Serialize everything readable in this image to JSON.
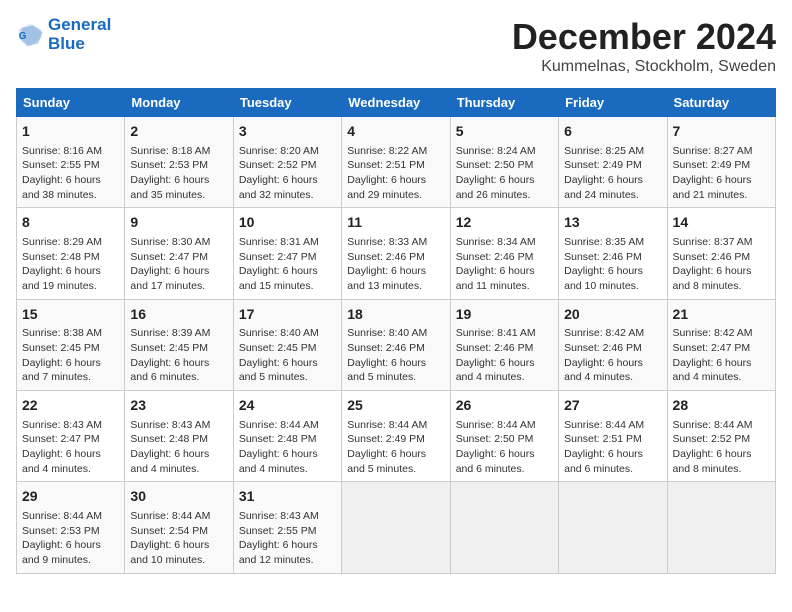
{
  "header": {
    "logo_line1": "General",
    "logo_line2": "Blue",
    "title": "December 2024",
    "subtitle": "Kummelnas, Stockholm, Sweden"
  },
  "columns": [
    "Sunday",
    "Monday",
    "Tuesday",
    "Wednesday",
    "Thursday",
    "Friday",
    "Saturday"
  ],
  "weeks": [
    [
      {
        "day": "1",
        "info": "Sunrise: 8:16 AM\nSunset: 2:55 PM\nDaylight: 6 hours\nand 38 minutes."
      },
      {
        "day": "2",
        "info": "Sunrise: 8:18 AM\nSunset: 2:53 PM\nDaylight: 6 hours\nand 35 minutes."
      },
      {
        "day": "3",
        "info": "Sunrise: 8:20 AM\nSunset: 2:52 PM\nDaylight: 6 hours\nand 32 minutes."
      },
      {
        "day": "4",
        "info": "Sunrise: 8:22 AM\nSunset: 2:51 PM\nDaylight: 6 hours\nand 29 minutes."
      },
      {
        "day": "5",
        "info": "Sunrise: 8:24 AM\nSunset: 2:50 PM\nDaylight: 6 hours\nand 26 minutes."
      },
      {
        "day": "6",
        "info": "Sunrise: 8:25 AM\nSunset: 2:49 PM\nDaylight: 6 hours\nand 24 minutes."
      },
      {
        "day": "7",
        "info": "Sunrise: 8:27 AM\nSunset: 2:49 PM\nDaylight: 6 hours\nand 21 minutes."
      }
    ],
    [
      {
        "day": "8",
        "info": "Sunrise: 8:29 AM\nSunset: 2:48 PM\nDaylight: 6 hours\nand 19 minutes."
      },
      {
        "day": "9",
        "info": "Sunrise: 8:30 AM\nSunset: 2:47 PM\nDaylight: 6 hours\nand 17 minutes."
      },
      {
        "day": "10",
        "info": "Sunrise: 8:31 AM\nSunset: 2:47 PM\nDaylight: 6 hours\nand 15 minutes."
      },
      {
        "day": "11",
        "info": "Sunrise: 8:33 AM\nSunset: 2:46 PM\nDaylight: 6 hours\nand 13 minutes."
      },
      {
        "day": "12",
        "info": "Sunrise: 8:34 AM\nSunset: 2:46 PM\nDaylight: 6 hours\nand 11 minutes."
      },
      {
        "day": "13",
        "info": "Sunrise: 8:35 AM\nSunset: 2:46 PM\nDaylight: 6 hours\nand 10 minutes."
      },
      {
        "day": "14",
        "info": "Sunrise: 8:37 AM\nSunset: 2:46 PM\nDaylight: 6 hours\nand 8 minutes."
      }
    ],
    [
      {
        "day": "15",
        "info": "Sunrise: 8:38 AM\nSunset: 2:45 PM\nDaylight: 6 hours\nand 7 minutes."
      },
      {
        "day": "16",
        "info": "Sunrise: 8:39 AM\nSunset: 2:45 PM\nDaylight: 6 hours\nand 6 minutes."
      },
      {
        "day": "17",
        "info": "Sunrise: 8:40 AM\nSunset: 2:45 PM\nDaylight: 6 hours\nand 5 minutes."
      },
      {
        "day": "18",
        "info": "Sunrise: 8:40 AM\nSunset: 2:46 PM\nDaylight: 6 hours\nand 5 minutes."
      },
      {
        "day": "19",
        "info": "Sunrise: 8:41 AM\nSunset: 2:46 PM\nDaylight: 6 hours\nand 4 minutes."
      },
      {
        "day": "20",
        "info": "Sunrise: 8:42 AM\nSunset: 2:46 PM\nDaylight: 6 hours\nand 4 minutes."
      },
      {
        "day": "21",
        "info": "Sunrise: 8:42 AM\nSunset: 2:47 PM\nDaylight: 6 hours\nand 4 minutes."
      }
    ],
    [
      {
        "day": "22",
        "info": "Sunrise: 8:43 AM\nSunset: 2:47 PM\nDaylight: 6 hours\nand 4 minutes."
      },
      {
        "day": "23",
        "info": "Sunrise: 8:43 AM\nSunset: 2:48 PM\nDaylight: 6 hours\nand 4 minutes."
      },
      {
        "day": "24",
        "info": "Sunrise: 8:44 AM\nSunset: 2:48 PM\nDaylight: 6 hours\nand 4 minutes."
      },
      {
        "day": "25",
        "info": "Sunrise: 8:44 AM\nSunset: 2:49 PM\nDaylight: 6 hours\nand 5 minutes."
      },
      {
        "day": "26",
        "info": "Sunrise: 8:44 AM\nSunset: 2:50 PM\nDaylight: 6 hours\nand 6 minutes."
      },
      {
        "day": "27",
        "info": "Sunrise: 8:44 AM\nSunset: 2:51 PM\nDaylight: 6 hours\nand 6 minutes."
      },
      {
        "day": "28",
        "info": "Sunrise: 8:44 AM\nSunset: 2:52 PM\nDaylight: 6 hours\nand 8 minutes."
      }
    ],
    [
      {
        "day": "29",
        "info": "Sunrise: 8:44 AM\nSunset: 2:53 PM\nDaylight: 6 hours\nand 9 minutes."
      },
      {
        "day": "30",
        "info": "Sunrise: 8:44 AM\nSunset: 2:54 PM\nDaylight: 6 hours\nand 10 minutes."
      },
      {
        "day": "31",
        "info": "Sunrise: 8:43 AM\nSunset: 2:55 PM\nDaylight: 6 hours\nand 12 minutes."
      },
      {
        "day": "",
        "info": ""
      },
      {
        "day": "",
        "info": ""
      },
      {
        "day": "",
        "info": ""
      },
      {
        "day": "",
        "info": ""
      }
    ]
  ]
}
